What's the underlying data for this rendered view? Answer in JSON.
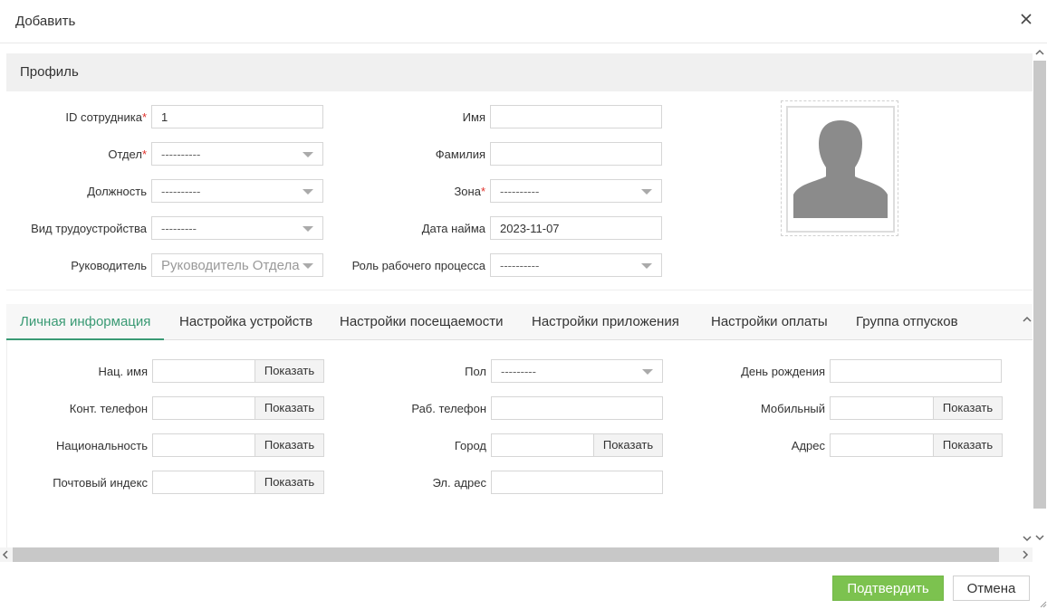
{
  "dialog": {
    "title": "Добавить",
    "close_icon": "close-icon"
  },
  "profile": {
    "section_title": "Профиль",
    "employee_id": {
      "label": "ID сотрудника",
      "required_mark": "*",
      "value": "1"
    },
    "department": {
      "label": "Отдел",
      "required_mark": "*",
      "value": "----------"
    },
    "position": {
      "label": "Должность",
      "value": "----------"
    },
    "employment_type": {
      "label": "Вид трудоустройства",
      "value": "---------"
    },
    "manager": {
      "label": "Руководитель",
      "value": "Руководитель Отдела"
    },
    "first_name": {
      "label": "Имя",
      "value": ""
    },
    "last_name": {
      "label": "Фамилия",
      "value": ""
    },
    "area": {
      "label": "Зона",
      "required_mark": "*",
      "value": "----------"
    },
    "hire_date": {
      "label": "Дата найма",
      "value": "2023-11-07"
    },
    "workflow_role": {
      "label": "Роль рабочего процесса",
      "value": "----------"
    },
    "photo_icon": "avatar-placeholder-icon"
  },
  "tabs": [
    {
      "label": "Личная информация",
      "active": true
    },
    {
      "label": "Настройка устройств",
      "active": false
    },
    {
      "label": "Настройки посещаемости",
      "active": false
    },
    {
      "label": "Настройки приложения",
      "active": false
    },
    {
      "label": "Настройки оплаты",
      "active": false
    },
    {
      "label": "Группа отпусков",
      "active": false
    }
  ],
  "personal": {
    "show_label": "Показать",
    "national_name": {
      "label": "Нац. имя",
      "value": ""
    },
    "contact_phone": {
      "label": "Конт. телефон",
      "value": ""
    },
    "nationality": {
      "label": "Национальность",
      "value": ""
    },
    "postal_code": {
      "label": "Почтовый индекс",
      "value": ""
    },
    "gender": {
      "label": "Пол",
      "value": "---------"
    },
    "work_phone": {
      "label": "Раб. телефон",
      "value": ""
    },
    "city": {
      "label": "Город",
      "value": ""
    },
    "email": {
      "label": "Эл. адрес",
      "value": ""
    },
    "birthday": {
      "label": "День рождения",
      "value": ""
    },
    "mobile": {
      "label": "Мобильный",
      "value": ""
    },
    "address": {
      "label": "Адрес",
      "value": ""
    }
  },
  "footer": {
    "confirm_label": "Подтвердить",
    "cancel_label": "Отмена"
  },
  "colors": {
    "accent": "#3a9a74",
    "confirm_bg": "#7cc24f",
    "required": "#e0312b"
  }
}
